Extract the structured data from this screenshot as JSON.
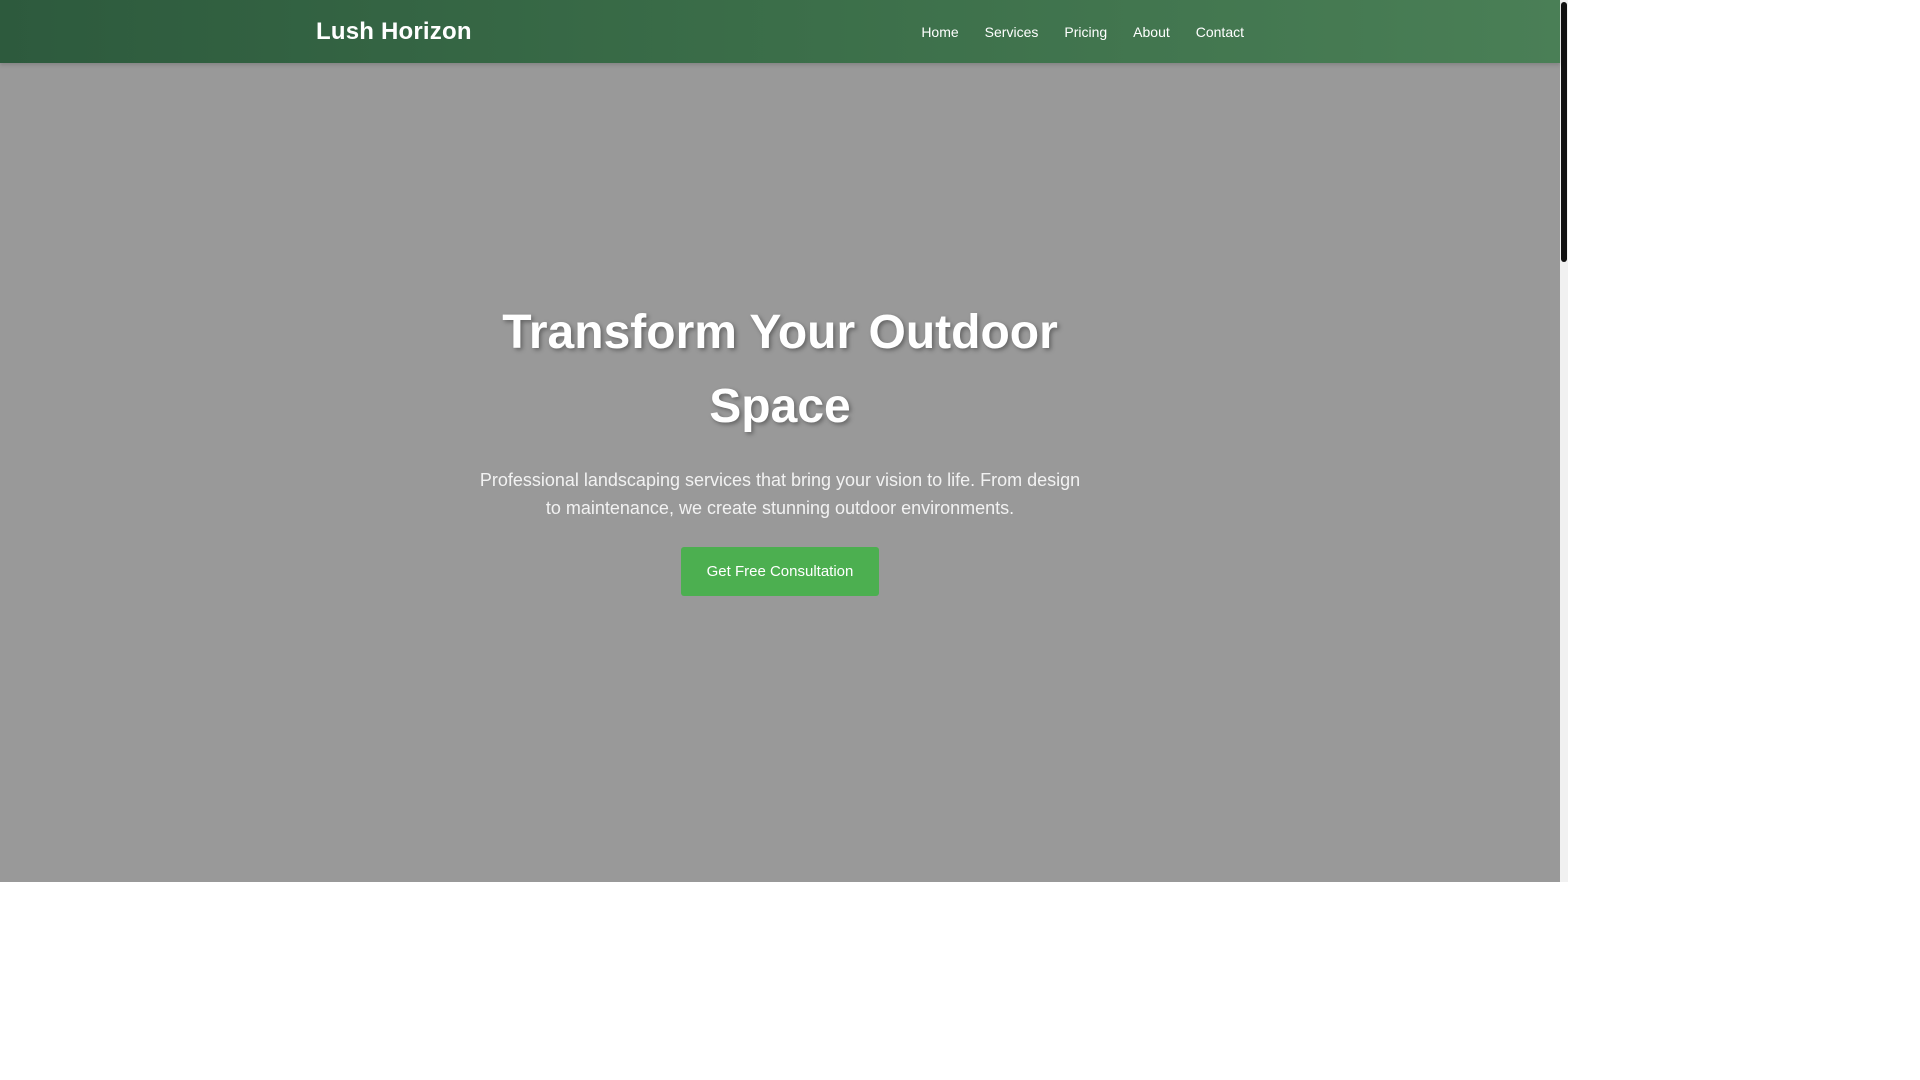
{
  "header": {
    "logo": "Lush Horizon",
    "nav": [
      {
        "label": "Home"
      },
      {
        "label": "Services"
      },
      {
        "label": "Pricing"
      },
      {
        "label": "About"
      },
      {
        "label": "Contact"
      }
    ]
  },
  "hero": {
    "title": "Transform Your Outdoor Space",
    "subtitle": "Professional landscaping services that bring your vision to life. From design to maintenance, we create stunning outdoor environments.",
    "cta_label": "Get Free Consultation"
  },
  "colors": {
    "nav_gradient_start": "#2d5a3d",
    "nav_gradient_end": "#4a7f56",
    "hero_background": "#999999",
    "cta_green": "#4caf50",
    "text_white": "#ffffff"
  }
}
